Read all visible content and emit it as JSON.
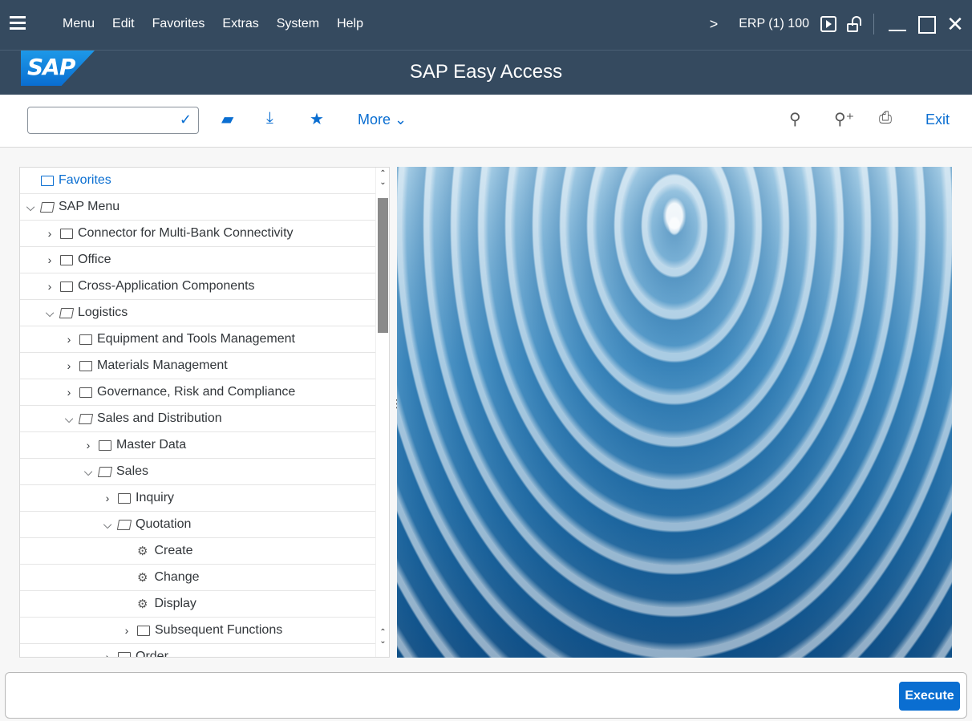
{
  "menubar": {
    "items": [
      "Menu",
      "Edit",
      "Favorites",
      "Extras",
      "System",
      "Help"
    ],
    "system": "ERP (1) 100"
  },
  "header": {
    "logo_text": "SAP",
    "title": "SAP Easy Access"
  },
  "toolbar": {
    "command_value": "",
    "more_label": "More",
    "exit_label": "Exit"
  },
  "tree": [
    {
      "label": "Favorites",
      "level": 0,
      "state": "collapsed",
      "kind": "folder",
      "link": true,
      "arrow": false
    },
    {
      "label": "SAP Menu",
      "level": 0,
      "state": "expanded",
      "kind": "folder",
      "arrow": true
    },
    {
      "label": "Connector for Multi-Bank Connectivity",
      "level": 1,
      "state": "collapsed",
      "kind": "folder",
      "arrow": true
    },
    {
      "label": "Office",
      "level": 1,
      "state": "collapsed",
      "kind": "folder",
      "arrow": true
    },
    {
      "label": "Cross-Application Components",
      "level": 1,
      "state": "collapsed",
      "kind": "folder",
      "arrow": true
    },
    {
      "label": "Logistics",
      "level": 1,
      "state": "expanded",
      "kind": "folder",
      "arrow": true
    },
    {
      "label": "Equipment and Tools Management",
      "level": 2,
      "state": "collapsed",
      "kind": "folder",
      "arrow": true
    },
    {
      "label": "Materials Management",
      "level": 2,
      "state": "collapsed",
      "kind": "folder",
      "arrow": true
    },
    {
      "label": "Governance, Risk and Compliance",
      "level": 2,
      "state": "collapsed",
      "kind": "folder",
      "arrow": true
    },
    {
      "label": "Sales and Distribution",
      "level": 2,
      "state": "expanded",
      "kind": "folder",
      "arrow": true
    },
    {
      "label": "Master Data",
      "level": 3,
      "state": "collapsed",
      "kind": "folder",
      "arrow": true
    },
    {
      "label": "Sales",
      "level": 3,
      "state": "expanded",
      "kind": "folder",
      "arrow": true
    },
    {
      "label": "Inquiry",
      "level": 4,
      "state": "collapsed",
      "kind": "folder",
      "arrow": true
    },
    {
      "label": "Quotation",
      "level": 4,
      "state": "expanded",
      "kind": "folder",
      "arrow": true
    },
    {
      "label": "Create",
      "level": 5,
      "state": "leaf",
      "kind": "transaction",
      "arrow": false
    },
    {
      "label": "Change",
      "level": 5,
      "state": "leaf",
      "kind": "transaction",
      "arrow": false
    },
    {
      "label": "Display",
      "level": 5,
      "state": "leaf",
      "kind": "transaction",
      "arrow": false
    },
    {
      "label": "Subsequent Functions",
      "level": 5,
      "state": "collapsed",
      "kind": "folder",
      "arrow": true
    },
    {
      "label": "Order",
      "level": 4,
      "state": "collapsed",
      "kind": "folder",
      "arrow": true
    }
  ],
  "footer": {
    "execute_label": "Execute"
  },
  "colors": {
    "shell": "#354a5f",
    "accent": "#0a6ed1"
  }
}
